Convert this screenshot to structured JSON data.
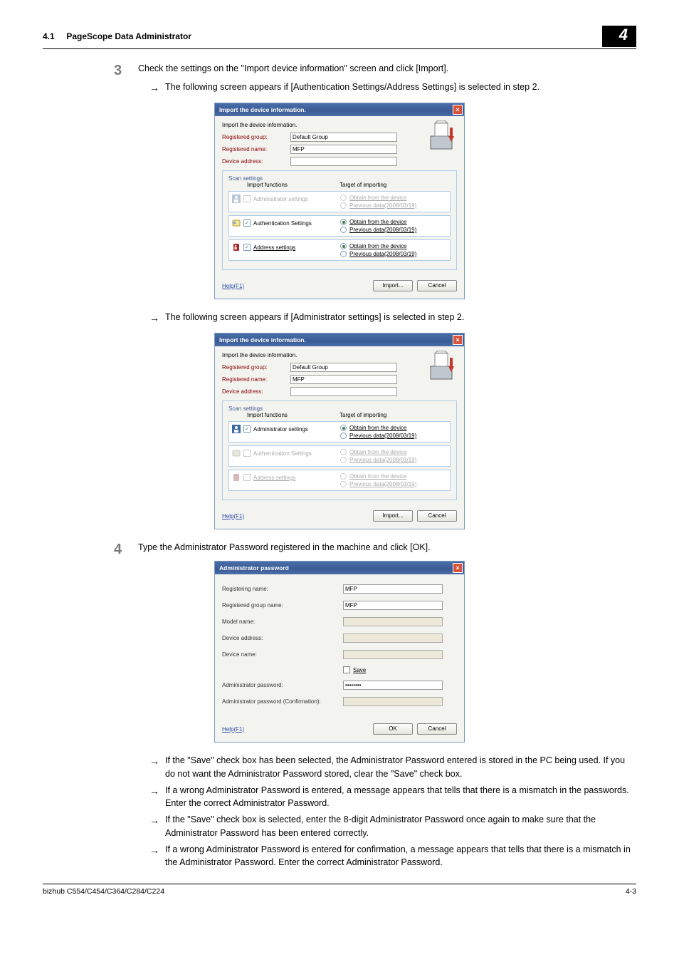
{
  "header": {
    "section_no": "4.1",
    "section_title": "PageScope Data Administrator",
    "chapter_no": "4"
  },
  "step3": {
    "number": "3",
    "text": "Check the settings on the \"Import device information\" screen and click [Import].",
    "arrow1": "The following screen appears if [Authentication Settings/Address Settings] is selected in step 2.",
    "arrow2": "The following screen appears if [Administrator settings] is selected in step 2."
  },
  "dlg1": {
    "title": "Import the device information.",
    "caption": "Import the device information.",
    "labels": {
      "reg_group": "Registered group:",
      "reg_name": "Registered name:",
      "dev_addr": "Device address:"
    },
    "values": {
      "reg_group": "Default Group",
      "reg_name": "MFP"
    },
    "scan_title": "Scan settings",
    "cols": {
      "left": "Import functions",
      "right": "Target of importing"
    },
    "rows": {
      "admin": {
        "label": "Administrator settings",
        "enabled": false,
        "checked": false
      },
      "auth": {
        "label": "Authentication Settings",
        "enabled": true,
        "checked": true
      },
      "addr": {
        "label": "Address settings",
        "enabled": true,
        "checked": true
      }
    },
    "radios": {
      "obtain": "Obtain from the device",
      "prev": "Previous data(2008/03/19)"
    },
    "help": "Help(F1)",
    "import_btn": "Import...",
    "cancel_btn": "Cancel"
  },
  "dlg2": {
    "title": "Import the device information.",
    "caption": "Import the device information.",
    "labels": {
      "reg_group": "Registered group:",
      "reg_name": "Registered name:",
      "dev_addr": "Device address:"
    },
    "values": {
      "reg_group": "Default Group",
      "reg_name": "MFP"
    },
    "scan_title": "Scan settings",
    "cols": {
      "left": "Import functions",
      "right": "Target of importing"
    },
    "rows": {
      "admin": {
        "label": "Administrator settings",
        "enabled": true,
        "checked": true
      },
      "auth": {
        "label": "Authentication Settings",
        "enabled": false,
        "checked": false
      },
      "addr": {
        "label": "Address settings",
        "enabled": false,
        "checked": false
      }
    },
    "radios": {
      "obtain": "Obtain from the device",
      "prev": "Previous data(2008/03/19)"
    },
    "help": "Help(F1)",
    "import_btn": "Import...",
    "cancel_btn": "Cancel"
  },
  "step4": {
    "number": "4",
    "text": "Type the Administrator Password registered in the machine and click [OK]."
  },
  "dlg3": {
    "title": "Administrator password",
    "labels": {
      "reg_name": "Registering name:",
      "reg_group": "Registered group name:",
      "model": "Model name:",
      "dev_addr": "Device address:",
      "dev_name": "Device name:",
      "save": "Save",
      "pw": "Administrator password:",
      "pw2": "Administrator password  (Confirmation):"
    },
    "values": {
      "reg_name": "MFP",
      "reg_group": "MFP",
      "pw": "••••••••"
    },
    "help": "Help(F1)",
    "ok_btn": "OK",
    "cancel_btn": "Cancel"
  },
  "notes": {
    "a": "If the \"Save\" check box has been selected, the Administrator Password entered is stored in the PC being used. If you do not want the Administrator Password stored, clear the \"Save\" check box.",
    "b": "If a wrong Administrator Password is entered, a message appears that tells that there is a mismatch in the passwords. Enter the correct Administrator Password.",
    "c": "If the \"Save\" check box is selected, enter the 8-digit Administrator Password once again to make sure that the Administrator Password has been entered correctly.",
    "d": "If a wrong Administrator Password is entered for confirmation, a message appears that tells that there is a mismatch in the Administrator Password. Enter the correct Administrator Password."
  },
  "footer": {
    "model": "bizhub C554/C454/C364/C284/C224",
    "page": "4-3"
  }
}
